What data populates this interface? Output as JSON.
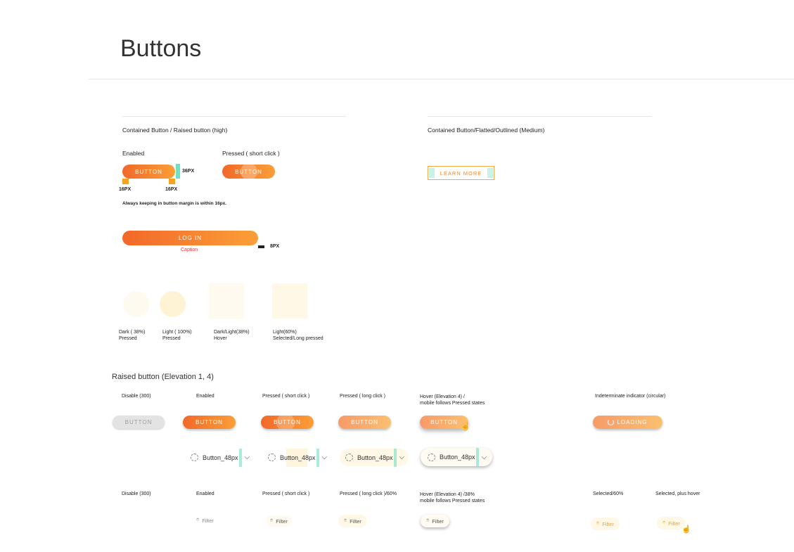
{
  "page": {
    "title": "Buttons"
  },
  "contained_high": {
    "heading": "Contained Button / Raised button (high)",
    "enabled_label": "Enabled",
    "pressed_label": "Pressed ( short click )",
    "button_label": "BUTTON",
    "height_note": "36PX",
    "margin_left": "16PX",
    "margin_right": "16PX",
    "margin_note": "Always keeping in button margin is within 16px.",
    "login_label": "LOG IN",
    "caption": "Caption",
    "spacing_note": "8PX"
  },
  "contained_medium": {
    "heading": "Contained Button/Flatted/Outlined (Medium)",
    "learn_more": "LEARN MORE"
  },
  "swatches": [
    {
      "line1": "Dark ( 38%)",
      "line2": "Pressed"
    },
    {
      "line1": "Light ( 100%)",
      "line2": "Pressed"
    },
    {
      "line1": "Dark/Light(38%)",
      "line2": "Hover"
    },
    {
      "line1": "Light(60%)",
      "line2": "Selected/Long pressed"
    }
  ],
  "raised": {
    "heading": "Raised button (Elevation 1, 4)",
    "states": {
      "disable": "Disable (300)",
      "enabled": "Enabled",
      "pressed_short": "Pressed ( short click )",
      "pressed_long": "Pressed ( long click )",
      "hover_line1": "Hover (Elevation 4) /",
      "hover_line2": "mobile follows Pressed states",
      "indeterminate": "Indeterminate indicator (circular)"
    },
    "button_label": "BUTTON",
    "loading_label": "LOADING",
    "chip_label": "Button_48px"
  },
  "filters": {
    "states": {
      "disable": "Disable (300)",
      "enabled": "Enabled",
      "pressed_short": "Pressed ( short click )",
      "pressed_long": "Pressed ( long click )/60%",
      "hover_line1": "Hover (Elevation 4) /38%",
      "hover_line2": "mobile follows Pressed states",
      "selected": "Selected/60%",
      "selected_hover": "Selected, plus hover"
    },
    "filter_label": "Filter"
  },
  "colors": {
    "accent_start": "#f2682a",
    "accent_end": "#fb9f37",
    "tag_orange": "#f6a11f",
    "tag_teal": "#6ee0c4",
    "caption_red": "#e53935"
  }
}
